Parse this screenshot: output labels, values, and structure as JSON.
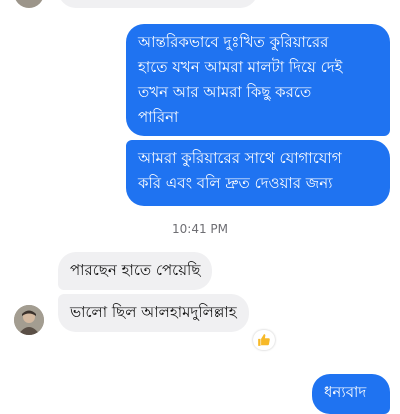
{
  "messages": {
    "out_1": "আন্তরিকভাবে দুঃখিত কুরিয়ারের\nহাতে যখন আমরা মালটা দিয়ে দেই\nতখন আর আমরা কিছু করতে\nপারিনা",
    "out_2": "আমরা কুরিয়ারের সাথে যোগাযোগ\nকরি এবং বলি দ্রুত দেওয়ার জন্য",
    "timestamp": "10:41 PM",
    "in_1": "পারছেন হাতে পেয়েছি",
    "in_2": "ভালো ছিল আলহামদুলিল্লাহ",
    "out_3": "ধন্যবাদ"
  },
  "reaction": {
    "icon": "thumbs-up-icon",
    "color": "#f7b928"
  },
  "colors": {
    "outgoing_bubble": "#1f73f1",
    "incoming_bubble": "#f0f0f2",
    "timestamp": "#6e6e73"
  }
}
